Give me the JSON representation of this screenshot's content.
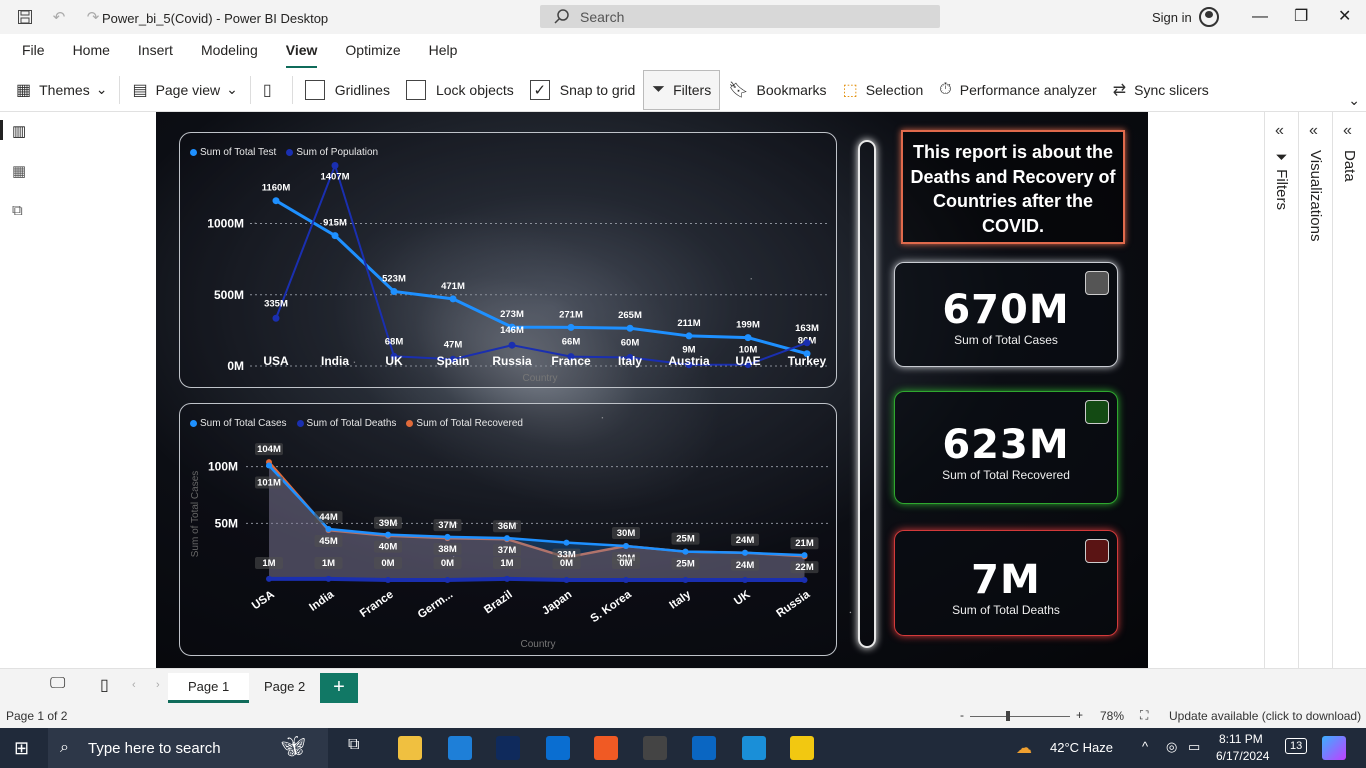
{
  "window": {
    "title": "Power_bi_5(Covid) - Power BI Desktop",
    "search_placeholder": "Search",
    "sign_in": "Sign in"
  },
  "menu": [
    "File",
    "Home",
    "Insert",
    "Modeling",
    "View",
    "Optimize",
    "Help"
  ],
  "menu_active": "View",
  "ribbon": {
    "themes": "Themes",
    "page_view": "Page view",
    "gridlines": "Gridlines",
    "lock_objects": "Lock objects",
    "snap_to_grid": "Snap to grid",
    "filters": "Filters",
    "bookmarks": "Bookmarks",
    "selection": "Selection",
    "performance": "Performance analyzer",
    "sync_slicers": "Sync slicers",
    "gridlines_checked": false,
    "lock_checked": false,
    "snap_checked": true
  },
  "report": {
    "title_box": "This report is about the Deaths and Recovery of Countries after the COVID.",
    "cards": [
      {
        "value": "670M",
        "label": "Sum of Total Cases",
        "accent": "#c9ccd2"
      },
      {
        "value": "623M",
        "label": "Sum of Total Recovered",
        "accent": "#2fa82f"
      },
      {
        "value": "7M",
        "label": "Sum of Total Deaths",
        "accent": "#d33a3a"
      }
    ]
  },
  "chart_data": [
    {
      "type": "line",
      "series": [
        {
          "name": "Sum of Total Test",
          "color": "#1e90ff",
          "values": [
            1160,
            915,
            523,
            471,
            273,
            271,
            265,
            211,
            199,
            86
          ],
          "labels": [
            "1160M",
            "915M",
            "523M",
            "471M",
            "273M",
            "271M",
            "265M",
            "211M",
            "199M",
            "86M"
          ]
        },
        {
          "name": "Sum of Population",
          "color": "#1a2fb0",
          "values": [
            335,
            1407,
            68,
            47,
            146,
            66,
            60,
            9,
            10,
            163
          ],
          "labels": [
            "335M",
            "1407M",
            "68M",
            "47M",
            "146M",
            "66M",
            "60M",
            "9M",
            "10M",
            "163M"
          ]
        }
      ],
      "categories": [
        "USA",
        "India",
        "UK",
        "Spain",
        "Russia",
        "France",
        "Italy",
        "Austria",
        "UAE",
        "Turkey"
      ],
      "y_ticks": [
        "1000M",
        "500M",
        "0M"
      ],
      "xlabel": "Country",
      "ylim": [
        0,
        1200
      ]
    },
    {
      "type": "area",
      "series": [
        {
          "name": "Sum of Total Cases",
          "color": "#1e90ff",
          "values": [
            101,
            45,
            40,
            38,
            37,
            33,
            30,
            25,
            24,
            22
          ],
          "labels": [
            "101M",
            "45M",
            "40M",
            "38M",
            "37M",
            "33M",
            "30M",
            "25M",
            "24M",
            "22M"
          ]
        },
        {
          "name": "Sum of Total Deaths",
          "color": "#1a2fb0",
          "values": [
            1,
            1,
            0,
            0,
            1,
            0,
            0,
            0,
            0,
            0
          ],
          "labels": [
            "1M",
            "1M",
            "0M",
            "0M",
            "1M",
            "0M",
            "0M",
            "",
            "",
            ""
          ]
        },
        {
          "name": "Sum of Total Recovered",
          "color": "#e06a3a",
          "values": [
            104,
            44,
            39,
            37,
            36,
            20,
            30,
            25,
            24,
            21
          ],
          "labels": [
            "104M",
            "44M",
            "39M",
            "37M",
            "36M",
            "",
            "30M",
            "25M",
            "24M",
            "21M"
          ]
        }
      ],
      "categories": [
        "USA",
        "India",
        "France",
        "Germ...",
        "Brazil",
        "Japan",
        "S. Korea",
        "Italy",
        "UK",
        "Russia"
      ],
      "y_ticks": [
        "100M",
        "50M"
      ],
      "xlabel": "Country",
      "ylabel": "Sum of Total Cases",
      "ylim": [
        0,
        120
      ]
    }
  ],
  "pages": {
    "tabs": [
      "Page 1",
      "Page 2"
    ],
    "active": "Page 1",
    "add": "+"
  },
  "status": {
    "page_info": "Page 1 of 2",
    "zoom": "78%",
    "update": "Update available (click to download)",
    "zoom_minus": "-",
    "zoom_plus": "+"
  },
  "panes": {
    "filters": "Filters",
    "visualizations": "Visualizations",
    "data": "Data"
  },
  "taskbar": {
    "search": "Type here to search",
    "weather": "42°C  Haze",
    "time": "8:11 PM",
    "date": "6/17/2024",
    "notifications": "13"
  }
}
